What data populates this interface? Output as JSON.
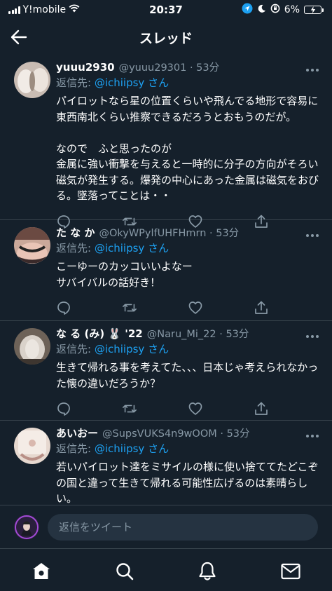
{
  "status_bar": {
    "carrier": "Y!mobile",
    "time": "20:37",
    "battery_percent": "6%"
  },
  "header": {
    "title": "スレッド"
  },
  "tweets": [
    {
      "username": "yuuu2930",
      "meta": "@yuuu29301 · 53分",
      "reply_prefix": "返信先:",
      "reply_mention": "@ichiipsy",
      "reply_suffix": "さん",
      "text": "パイロットなら星の位置くらいや飛んでる地形で容易に東西南北くらい推察できるだろうとおもうのだが。\n\nなので　ふと思ったのが\n金属に強い衝撃を与えると一時的に分子の方向がそろい磁気が発生する。爆発の中心にあった金属は磁気をおびる。墜落ってことは・・"
    },
    {
      "username": "た な か",
      "meta": "@OkyWPylfUHFHmrn · 53分",
      "reply_prefix": "返信先:",
      "reply_mention": "@ichiipsy",
      "reply_suffix": "さん",
      "text": "こーゆーのカッコいいよなー\nサバイバルの話好き！"
    },
    {
      "username": "な る (み) 🐰 '22",
      "meta": "@Naru_Mi_22 · 53分",
      "reply_prefix": "返信先:",
      "reply_mention": "@ichiipsy",
      "reply_suffix": "さん",
      "text": "生きて帰れる事を考えてた、、、日本じゃ考えられなかった懐の違いだろうか？"
    },
    {
      "username": "あいおー",
      "meta": "@SupsVUKS4n9wOOM · 53分",
      "reply_prefix": "返信先:",
      "reply_mention": "@ichiipsy",
      "reply_suffix": "さん",
      "text": "若いパイロット達をミサイルの様に使い捨ててたどこぞの国と違って生きて帰れる可能性広げるのは素晴らしい。"
    }
  ],
  "reply_bar": {
    "placeholder": "返信をツイート"
  },
  "colors": {
    "background": "#15202b",
    "accent": "#1da1f2",
    "secondary_text": "#8899a6",
    "divider": "#38444d"
  }
}
